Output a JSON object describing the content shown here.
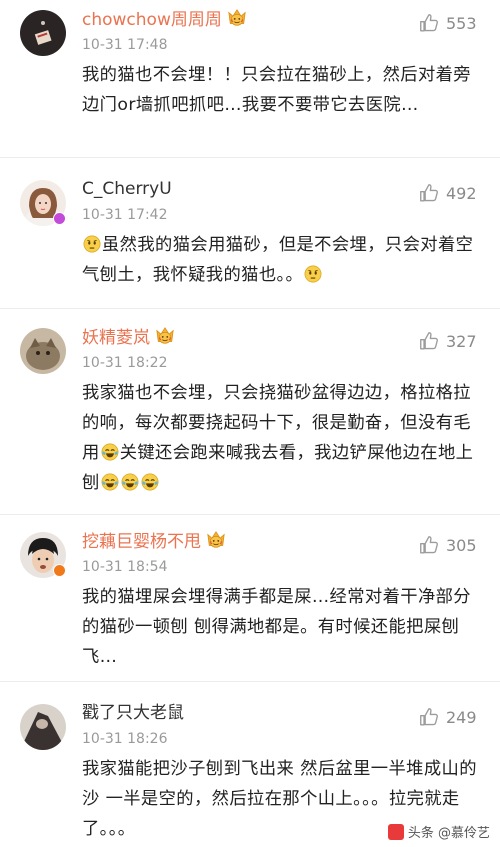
{
  "comments": [
    {
      "username": "chowchow周周周",
      "time": "10-31 17:48",
      "likes": "553",
      "text": "我的猫也不会埋！！只会拉在猫砂上，然后对着旁边门or墙抓吧抓吧…我要不要带它去医院…"
    },
    {
      "username": "C_CherryU",
      "time": "10-31 17:42",
      "likes": "492",
      "text_a": "虽然我的猫会用猫砂，但是不会埋，只会对着空气刨土，我怀疑我的猫也。。",
      "text_b": ""
    },
    {
      "username": "妖精菱岚",
      "time": "10-31 18:22",
      "likes": "327",
      "text_a": "我家猫也不会埋，只会挠猫砂盆得边边，格拉格拉的响，每次都要挠起码十下，很是勤奋，但没有毛用",
      "text_b": "关键还会跑来喊我去看，我边铲屎他边在地上刨"
    },
    {
      "username": "挖藕巨婴杨不甩",
      "time": "10-31 18:54",
      "likes": "305",
      "text": "我的猫埋屎会埋得满手都是屎…经常对着干净部分的猫砂一顿刨 刨得满地都是。有时候还能把屎刨飞…"
    },
    {
      "username": "戳了只大老鼠",
      "time": "10-31 18:26",
      "likes": "249",
      "text": "我家猫能把沙子刨到飞出来 然后盆里一半堆成山的沙 一半是空的，然后拉在那个山上。。。拉完就走了。。。"
    }
  ],
  "watermark": "头条 @慕伶艺",
  "colors": {
    "username_orange": "#eb7350",
    "timestamp": "#9a9a9a",
    "like_count": "#8a8a8a"
  },
  "icons": [
    "thumbs-up-icon",
    "vip-crown-badge-icon",
    "verified-badge-icon",
    "doubt-emoji-icon",
    "tears-of-joy-emoji-icon"
  ]
}
